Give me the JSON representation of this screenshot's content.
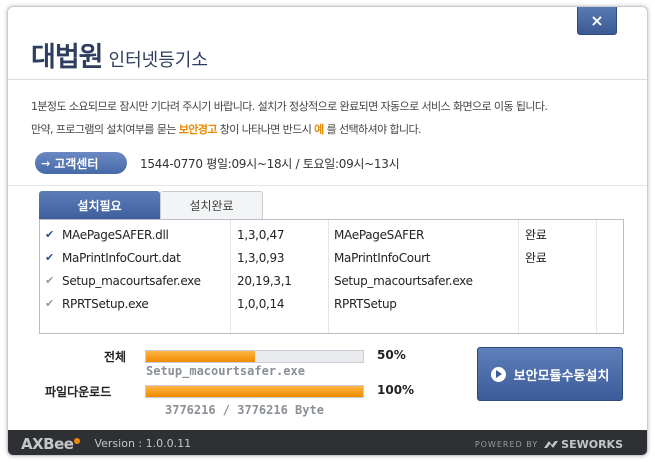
{
  "header": {
    "logo_main": "대법원",
    "logo_sub": "인터넷등기소",
    "close_label": "×"
  },
  "message": {
    "line1": "1분정도 소요되므로 잠시만 기다려 주시기 바랍니다. 설치가 정상적으로 완료되면 자동으로 서비스 화면으로 이동 됩니다.",
    "line2_a": "만약, 프로그램의 설치여부를 묻는 ",
    "line2_hl1": "보안경고",
    "line2_b": " 창이 나타나면 반드시 ",
    "line2_hl2": "예",
    "line2_c": " 를 선택하셔야 합니다."
  },
  "support": {
    "button_label": "고객센터",
    "info": "1544-0770  평일:09시~18시 / 토요일:09시~13시"
  },
  "tabs": [
    {
      "label": "설치필요"
    },
    {
      "label": "설치완료"
    }
  ],
  "modules": [
    {
      "file": "MAePageSAFER.dll",
      "version": "1,3,0,47",
      "name": "MAePageSAFER",
      "status": "완료"
    },
    {
      "file": "MaPrintInfoCourt.dat",
      "version": "1,3,0,93",
      "name": "MaPrintInfoCourt",
      "status": "완료"
    },
    {
      "file": "Setup_macourtsafer.exe",
      "version": "20,19,3,1",
      "name": "Setup_macourtsafer.exe",
      "status": ""
    },
    {
      "file": "RPRTSetup.exe",
      "version": "1,0,0,14",
      "name": "RPRTSetup",
      "status": ""
    }
  ],
  "progress": {
    "total_label": "전체",
    "total_percent": 50,
    "total_percent_text": "50%",
    "current_file": "Setup_macourtsafer.exe",
    "file_label": "파일다운로드",
    "file_percent": 100,
    "file_percent_text": "100%",
    "bytes_text": "3776216 / 3776216 Byte"
  },
  "install_button": {
    "label": "보안모듈수동설치"
  },
  "footer": {
    "brand": "AXBee",
    "version": "Version : 1.0.0.11",
    "powered": "POWERED BY",
    "company": "SEWORKS"
  },
  "colors": {
    "accent": "#4a6aa8",
    "highlight": "#e88a00",
    "progress_fill": "#f08a00",
    "footer_bg": "#2f3033"
  }
}
